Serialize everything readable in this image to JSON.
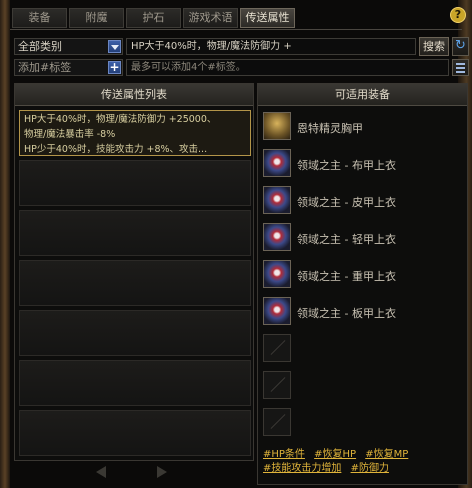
{
  "tabs": [
    {
      "label": "装备"
    },
    {
      "label": "附魔"
    },
    {
      "label": "护石"
    },
    {
      "label": "游戏术语"
    },
    {
      "label": "传送属性",
      "active": true
    }
  ],
  "help_label": "?",
  "filter": {
    "category_selected": "全部类别",
    "search_value": "HP大于40%时，物理/魔法防御力 +",
    "search_button": "搜索",
    "tag_placeholder": "添加#标签",
    "tag_hint": "最多可以添加4个#标签。"
  },
  "left_panel": {
    "title": "传送属性列表",
    "selected_entry": {
      "line1": "HP大于40%时，物理/魔法防御力 +25000、",
      "line2": "物理/魔法暴击率 -8%",
      "line3": "HP少于40%时，技能攻击力 +8%、攻击..."
    }
  },
  "right_panel": {
    "title": "可适用装备",
    "items": [
      {
        "name": "恩特精灵胸甲",
        "icon": "chest-armor-icon"
      },
      {
        "name": "领域之主 - 布甲上衣",
        "icon": "cloth-coat-icon"
      },
      {
        "name": "领域之主 - 皮甲上衣",
        "icon": "leather-coat-icon"
      },
      {
        "name": "领域之主 - 轻甲上衣",
        "icon": "light-coat-icon"
      },
      {
        "name": "领域之主 - 重甲上衣",
        "icon": "heavy-coat-icon"
      },
      {
        "name": "领域之主 - 板甲上衣",
        "icon": "plate-coat-icon"
      }
    ],
    "tags": [
      "#HP条件",
      "#恢复HP",
      "#恢复MP",
      "#技能攻击力增加",
      "#防御力"
    ]
  },
  "colors": {
    "accent_gold": "#e0b43a",
    "selected_border": "#b39549",
    "button_blue": "#3c5fa8"
  }
}
